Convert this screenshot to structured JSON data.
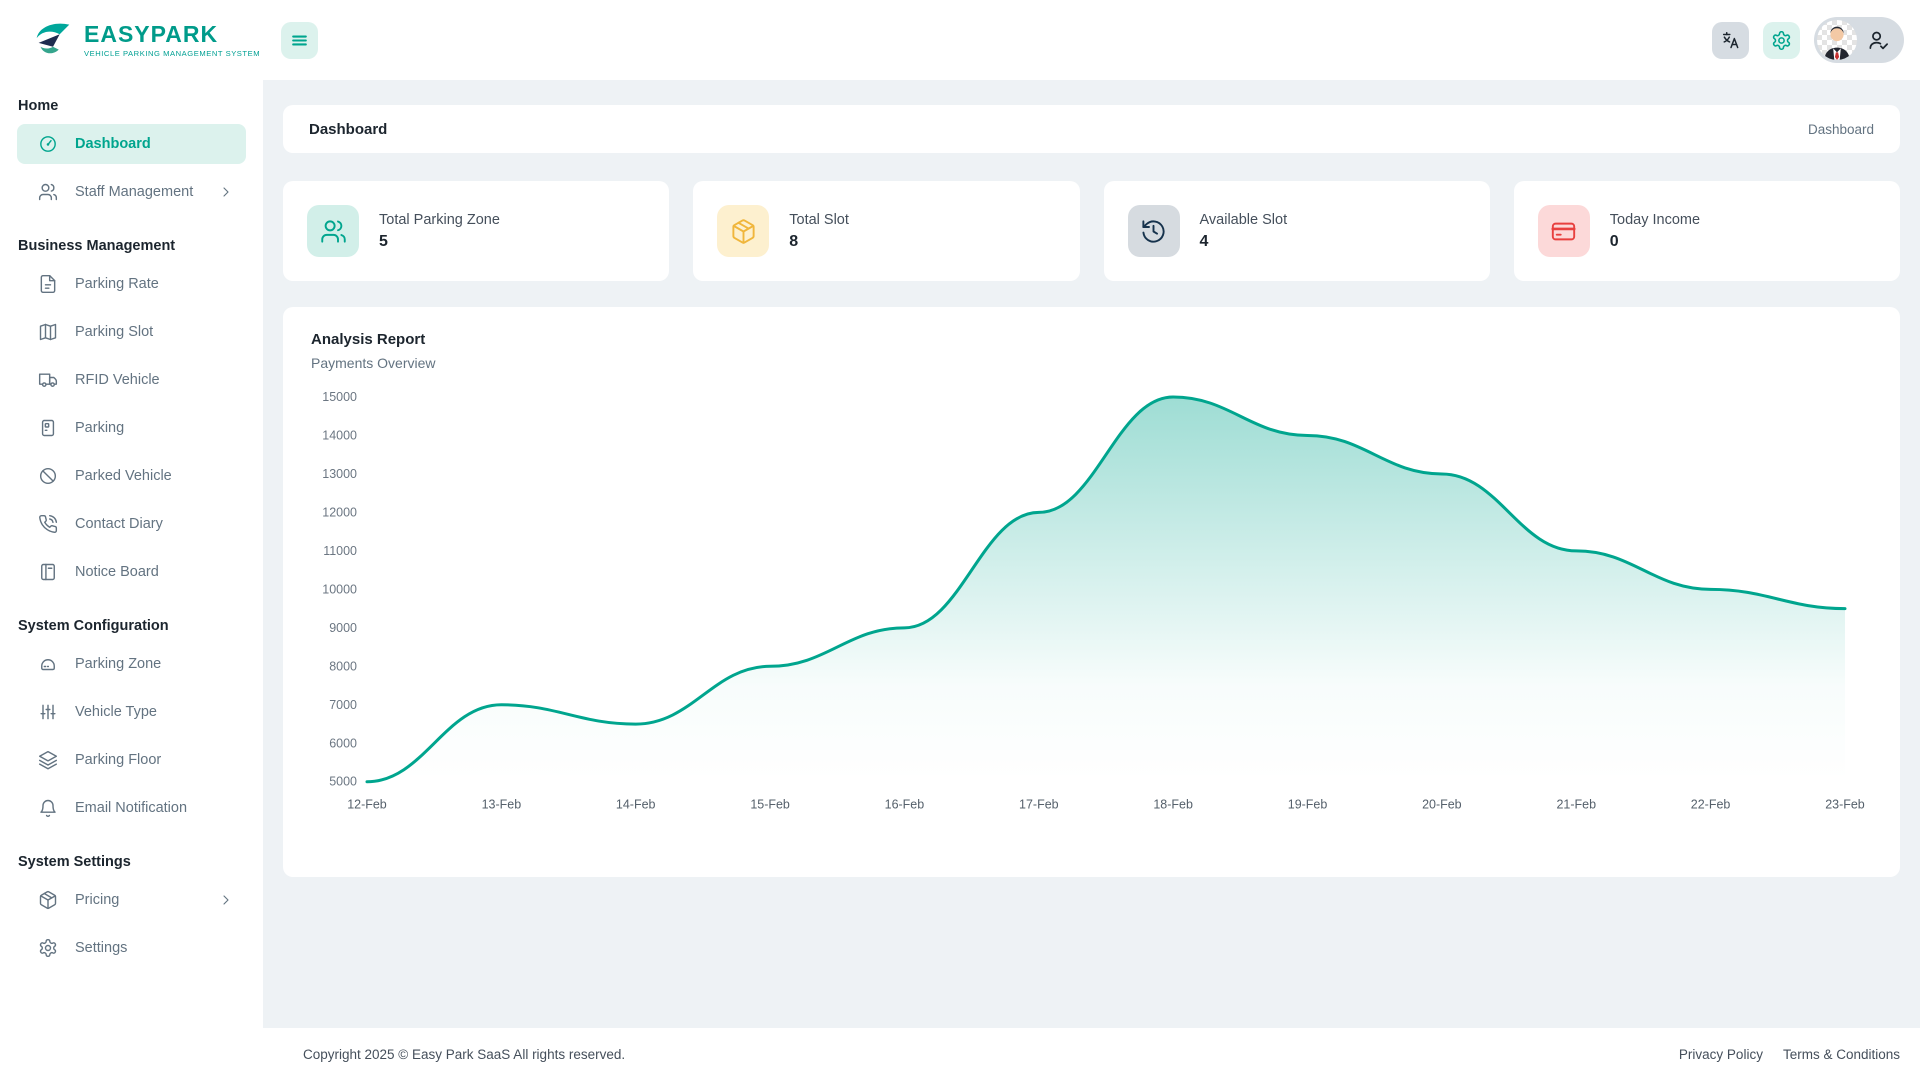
{
  "brand": {
    "name": "EASYPARK",
    "tagline": "VEHICLE PARKING MANAGEMENT SYSTEM"
  },
  "colors": {
    "accent": "#00a58e",
    "accent_light": "#dcf2ed",
    "body_bg": "#eef2f5",
    "yellow": "#f0b63c",
    "yellow_light": "#fdf0cf",
    "navy": "#16324c",
    "gray_light": "#d6dbe0",
    "red": "#e8403f",
    "red_light": "#fcd9d9"
  },
  "topbar": {
    "menu_icon": "menu-icon",
    "buttons": [
      {
        "name": "translate",
        "icon": "translate-icon"
      },
      {
        "name": "settings",
        "icon": "gear-icon"
      },
      {
        "name": "profile",
        "icon": "user-check-icon",
        "avatar": "avatar-man"
      }
    ]
  },
  "sidebar": {
    "sections": [
      {
        "title": "Home",
        "items": [
          {
            "label": "Dashboard",
            "icon": "gauge-icon",
            "active": true
          },
          {
            "label": "Staff Management",
            "icon": "users-icon",
            "has_submenu": true
          }
        ]
      },
      {
        "title": "Business Management",
        "items": [
          {
            "label": "Parking Rate",
            "icon": "file-text-icon"
          },
          {
            "label": "Parking Slot",
            "icon": "map-icon"
          },
          {
            "label": "RFID Vehicle",
            "icon": "truck-icon"
          },
          {
            "label": "Parking",
            "icon": "parking-meter-icon"
          },
          {
            "label": "Parked Vehicle",
            "icon": "ban-icon"
          },
          {
            "label": "Contact Diary",
            "icon": "phone-call-icon"
          },
          {
            "label": "Notice Board",
            "icon": "notice-board-icon"
          }
        ]
      },
      {
        "title": "System Configuration",
        "items": [
          {
            "label": "Parking Zone",
            "icon": "car-zone-icon"
          },
          {
            "label": "Vehicle Type",
            "icon": "sliders-icon"
          },
          {
            "label": "Parking Floor",
            "icon": "layers-icon"
          },
          {
            "label": "Email Notification",
            "icon": "bell-icon"
          }
        ]
      },
      {
        "title": "System Settings",
        "items": [
          {
            "label": "Pricing",
            "icon": "package-icon",
            "has_submenu": true
          },
          {
            "label": "Settings",
            "icon": "settings-icon"
          }
        ]
      }
    ]
  },
  "page_header": {
    "title": "Dashboard",
    "breadcrumb": "Dashboard"
  },
  "stats": [
    {
      "label": "Total Parking Zone",
      "value": "5",
      "icon": "users-icon",
      "icon_bg": "#d2efe9",
      "icon_fg": "#00a58e"
    },
    {
      "label": "Total Slot",
      "value": "8",
      "icon": "package-icon",
      "icon_bg": "#fdf0cf",
      "icon_fg": "#f0b63c"
    },
    {
      "label": "Available Slot",
      "value": "4",
      "icon": "history-icon",
      "icon_bg": "#d6dbe0",
      "icon_fg": "#16324c"
    },
    {
      "label": "Today Income",
      "value": "0",
      "icon": "credit-card-icon",
      "icon_bg": "#fcd9d9",
      "icon_fg": "#e8403f"
    }
  ],
  "chart_card": {
    "title": "Analysis Report",
    "subtitle": "Payments Overview"
  },
  "chart_data": {
    "type": "area",
    "title": "Analysis Report",
    "subtitle": "Payments Overview",
    "categories": [
      "12-Feb",
      "13-Feb",
      "14-Feb",
      "15-Feb",
      "16-Feb",
      "17-Feb",
      "18-Feb",
      "19-Feb",
      "20-Feb",
      "21-Feb",
      "22-Feb",
      "23-Feb"
    ],
    "series": [
      {
        "name": "Payments",
        "values": [
          5000,
          7000,
          6500,
          8000,
          9000,
          12000,
          15000,
          14000,
          13000,
          11000,
          10000,
          9500
        ]
      }
    ],
    "ylim": [
      5000,
      15000
    ],
    "ytick_step": 1000,
    "yticks": [
      "5000",
      "6000",
      "7000",
      "8000",
      "9000",
      "10000",
      "11000",
      "12000",
      "13000",
      "14000",
      "15000"
    ],
    "grid": false,
    "legend": "none",
    "line_color": "#00a58e",
    "fill": "teal gradient fading to transparent"
  },
  "footer": {
    "copyright": "Copyright 2025 © Easy Park SaaS All rights reserved.",
    "links": [
      {
        "label": "Privacy Policy"
      },
      {
        "label": "Terms & Conditions"
      }
    ]
  }
}
